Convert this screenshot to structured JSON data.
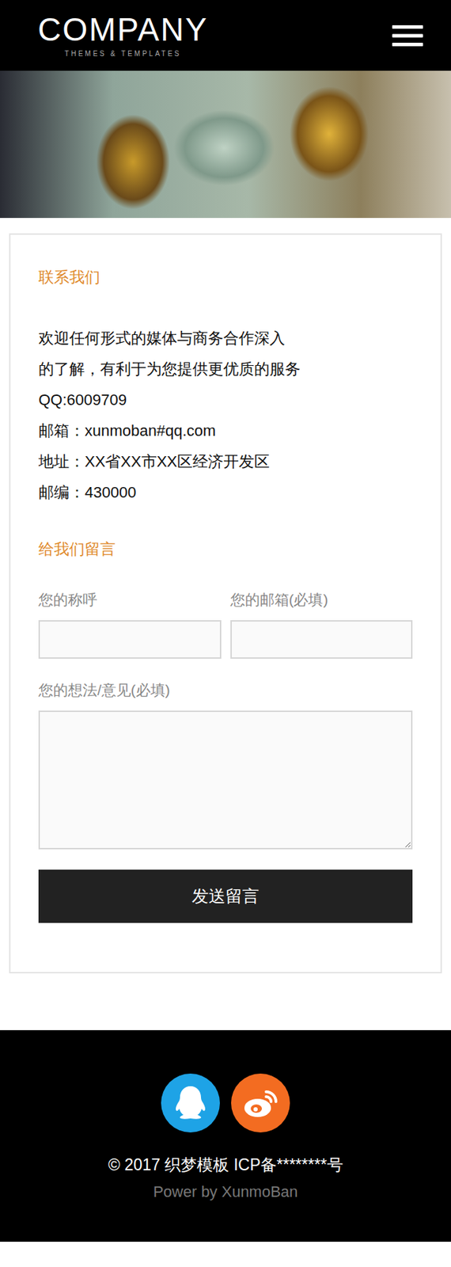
{
  "header": {
    "logo": "COMPANY",
    "tagline": "THEMES & TEMPLATES"
  },
  "contact": {
    "title": "联系我们",
    "lines": [
      "欢迎任何形式的媒体与商务合作深入",
      "的了解，有利于为您提供更优质的服务",
      "QQ:6009709",
      "邮箱：xunmoban#qq.com",
      "地址：XX省XX市XX区经济开发区",
      "邮编：430000"
    ]
  },
  "form": {
    "title": "给我们留言",
    "fields": [
      {
        "label": "您的称呼"
      },
      {
        "label": "您的邮箱(必填)"
      }
    ],
    "message_label": "您的想法/意见(必填)",
    "submit": "发送留言"
  },
  "footer": {
    "copyright": "© 2017 织梦模板 ICP备********号",
    "power": "Power by XunmoBan"
  }
}
